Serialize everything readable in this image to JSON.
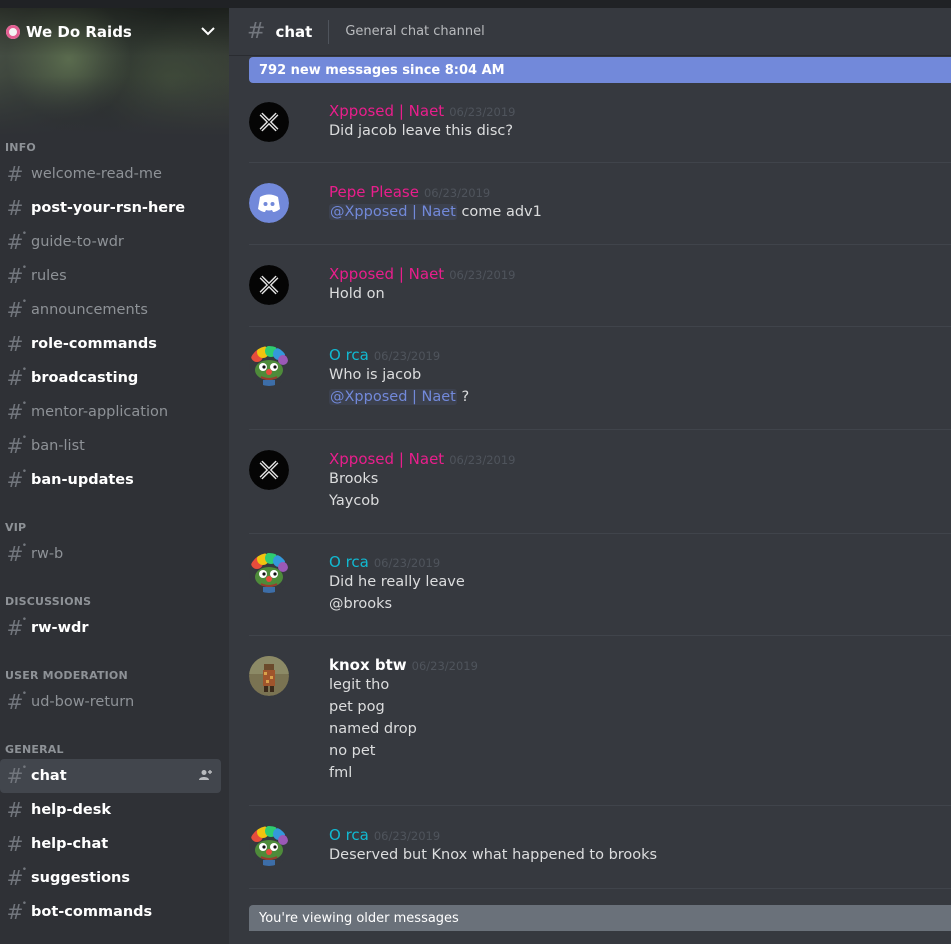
{
  "server": {
    "name": "We Do Raids"
  },
  "channel_categories": [
    {
      "name": "INFO",
      "channels": [
        {
          "label": "welcome-read-me",
          "unread": false,
          "locked": false
        },
        {
          "label": "post-your-rsn-here",
          "unread": true,
          "locked": false
        },
        {
          "label": "guide-to-wdr",
          "unread": false,
          "locked": true
        },
        {
          "label": "rules",
          "unread": false,
          "locked": true
        },
        {
          "label": "announcements",
          "unread": false,
          "locked": true
        },
        {
          "label": "role-commands",
          "unread": true,
          "locked": false
        },
        {
          "label": "broadcasting",
          "unread": true,
          "locked": true
        },
        {
          "label": "mentor-application",
          "unread": false,
          "locked": true
        },
        {
          "label": "ban-list",
          "unread": false,
          "locked": true
        },
        {
          "label": "ban-updates",
          "unread": true,
          "locked": true
        }
      ]
    },
    {
      "name": "VIP",
      "channels": [
        {
          "label": "rw-b",
          "unread": false,
          "locked": true
        }
      ]
    },
    {
      "name": "DISCUSSIONS",
      "channels": [
        {
          "label": "rw-wdr",
          "unread": true,
          "locked": true
        }
      ]
    },
    {
      "name": "USER MODERATION",
      "channels": [
        {
          "label": "ud-bow-return",
          "unread": false,
          "locked": true
        }
      ]
    },
    {
      "name": "GENERAL",
      "channels": [
        {
          "label": "chat",
          "unread": false,
          "locked": true,
          "active": true
        },
        {
          "label": "help-desk",
          "unread": true,
          "locked": false
        },
        {
          "label": "help-chat",
          "unread": true,
          "locked": false
        },
        {
          "label": "suggestions",
          "unread": true,
          "locked": true
        },
        {
          "label": "bot-commands",
          "unread": true,
          "locked": true
        }
      ]
    }
  ],
  "header": {
    "channel_name": "chat",
    "topic": "General chat channel"
  },
  "new_messages_bar": "792 new messages since 8:04 AM",
  "messages": [
    {
      "author": "Xpposed | Naet",
      "author_color": "#e91e8c",
      "avatar": "x-avatar",
      "timestamp": "06/23/2019",
      "lines": [
        {
          "text": "Did jacob leave this disc?"
        }
      ]
    },
    {
      "author": "Pepe Please",
      "author_color": "#e91e8c",
      "avatar": "discord-avatar",
      "timestamp": "06/23/2019",
      "lines": [
        {
          "mention": "@Xpposed | Naet",
          "text": " come adv1"
        }
      ]
    },
    {
      "author": "Xpposed | Naet",
      "author_color": "#e91e8c",
      "avatar": "x-avatar",
      "timestamp": "06/23/2019",
      "lines": [
        {
          "text": "Hold on"
        }
      ]
    },
    {
      "author": "O rca",
      "author_color": "#11b9d1",
      "avatar": "pepe-clown-avatar",
      "timestamp": "06/23/2019",
      "lines": [
        {
          "text": "Who is jacob"
        },
        {
          "mention": "@Xpposed | Naet",
          "text": " ?"
        }
      ]
    },
    {
      "author": "Xpposed | Naet",
      "author_color": "#e91e8c",
      "avatar": "x-avatar",
      "timestamp": "06/23/2019",
      "lines": [
        {
          "text": "Brooks"
        },
        {
          "text": "Yaycob"
        }
      ]
    },
    {
      "author": "O rca",
      "author_color": "#11b9d1",
      "avatar": "pepe-clown-avatar",
      "timestamp": "06/23/2019",
      "lines": [
        {
          "text": "Did he really leave"
        },
        {
          "text": "@brooks"
        }
      ]
    },
    {
      "author": "knox btw",
      "author_color": "#ffffff",
      "avatar": "knox-avatar",
      "timestamp": "06/23/2019",
      "lines": [
        {
          "text": "legit tho"
        },
        {
          "text": "pet pog"
        },
        {
          "text": "named drop"
        },
        {
          "text": "no pet"
        },
        {
          "text": "fml"
        }
      ]
    },
    {
      "author": "O rca",
      "author_color": "#11b9d1",
      "avatar": "pepe-clown-avatar",
      "timestamp": "06/23/2019",
      "lines": [
        {
          "text": "Deserved but Knox what happened to brooks"
        }
      ]
    }
  ],
  "older_messages_bar": "You're viewing older messages"
}
